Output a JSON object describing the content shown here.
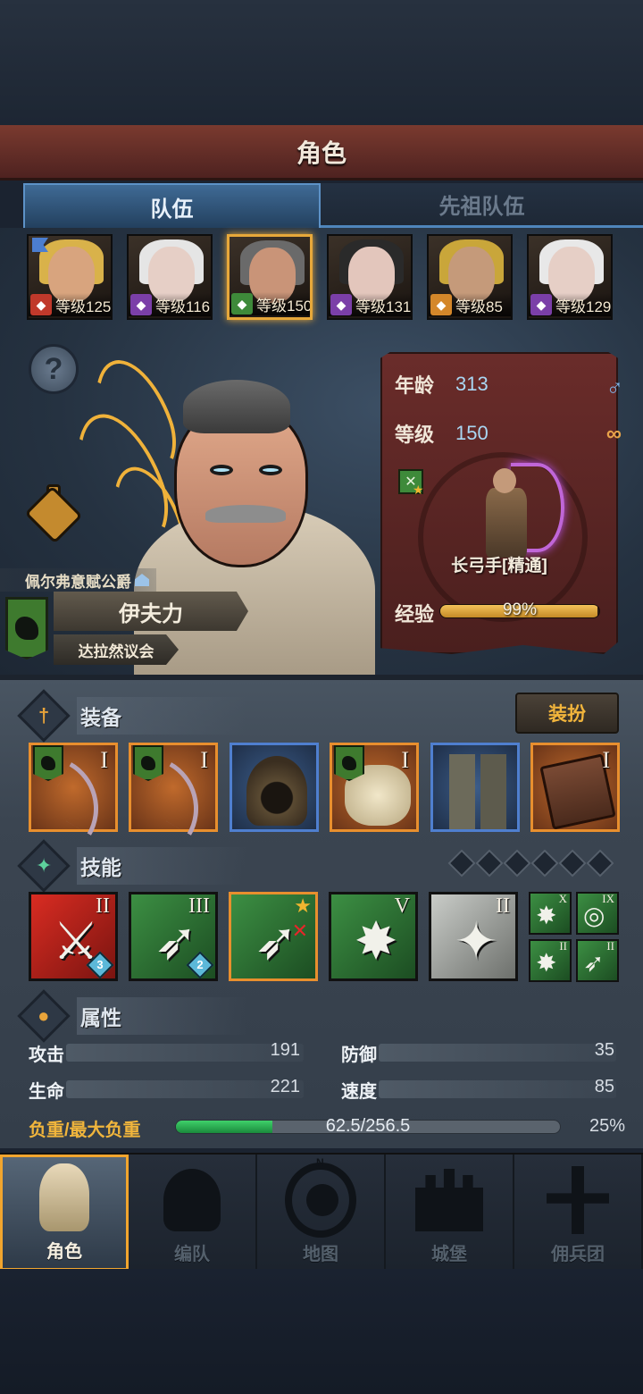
{
  "title": "角色",
  "tabs": {
    "team": "队伍",
    "ancestor_team": "先祖队伍"
  },
  "party": [
    {
      "level_text": "等级125",
      "class_color": "#c0392b",
      "class_icon": "horse-icon",
      "hair": "#d9b24a",
      "skin": "#d8a47e",
      "flag": true
    },
    {
      "level_text": "等级116",
      "class_color": "#7b3fa8",
      "class_icon": "staff-icon",
      "hair": "#e5e5e5",
      "skin": "#e6cfc6",
      "flag": false
    },
    {
      "level_text": "等级150",
      "class_color": "#3e8a3a",
      "class_icon": "bow-icon",
      "hair": "#6a6a6a",
      "skin": "#c99478",
      "flag": false,
      "selected": true
    },
    {
      "level_text": "等级131",
      "class_color": "#7b3fa8",
      "class_icon": "staff-icon",
      "hair": "#2a2a2a",
      "skin": "#e3c6bc",
      "flag": false
    },
    {
      "level_text": "等级85",
      "class_color": "#d4872a",
      "class_icon": "flame-icon",
      "hair": "#c9a63a",
      "skin": "#c59a7a",
      "flag": false
    },
    {
      "level_text": "等级129",
      "class_color": "#7b3fa8",
      "class_icon": "staff-icon",
      "hair": "#e8e8e8",
      "skin": "#e6cfc6",
      "flag": false
    }
  ],
  "hero": {
    "noble_title": "佩尔弗意赋公爵",
    "name": "伊夫力",
    "guild": "达拉然议会",
    "age_label": "年龄",
    "age": "313",
    "level_label": "等级",
    "level": "150",
    "class_name": "长弓手[精通]",
    "exp_label": "经验",
    "exp_text": "99%",
    "exp_fraction": 0.99
  },
  "equipment": {
    "section_title": "装备",
    "dress_button": "装扮",
    "items": [
      {
        "name": "bow",
        "tier": "I",
        "rarity": "orange",
        "banner": true
      },
      {
        "name": "bow-2",
        "tier": "I",
        "rarity": "orange",
        "banner": true
      },
      {
        "name": "hood",
        "tier": "",
        "rarity": "blue",
        "banner": false
      },
      {
        "name": "armor",
        "tier": "I",
        "rarity": "orange",
        "banner": true
      },
      {
        "name": "boots",
        "tier": "",
        "rarity": "blue",
        "banner": false
      },
      {
        "name": "book",
        "tier": "I",
        "rarity": "orange",
        "banner": false
      }
    ]
  },
  "skills": {
    "section_title": "技能",
    "dot_count": 6,
    "main": [
      {
        "tier": "II",
        "color": "red",
        "gem": "3"
      },
      {
        "tier": "III",
        "color": "green",
        "gem": "2"
      },
      {
        "tier": "",
        "color": "green",
        "selected": true,
        "starred": true
      },
      {
        "tier": "V",
        "color": "green"
      },
      {
        "tier": "II",
        "color": "grey"
      }
    ],
    "mini": [
      {
        "tier": "X"
      },
      {
        "tier": "IX"
      },
      {
        "tier": "II"
      },
      {
        "tier": "II"
      }
    ]
  },
  "attributes": {
    "section_title": "属性",
    "attack_label": "攻击",
    "attack": "191",
    "defense_label": "防御",
    "defense": "35",
    "hp_label": "生命",
    "hp": "221",
    "speed_label": "速度",
    "speed": "85",
    "load_label": "负重/最大负重",
    "load_text": "62.5/256.5",
    "load_percent": "25%",
    "load_fraction": 0.25
  },
  "nav": [
    {
      "label": "角色",
      "active": true
    },
    {
      "label": "编队",
      "active": false
    },
    {
      "label": "地图",
      "active": false
    },
    {
      "label": "城堡",
      "active": false
    },
    {
      "label": "佣兵团",
      "active": false
    }
  ],
  "compass_n": "N"
}
